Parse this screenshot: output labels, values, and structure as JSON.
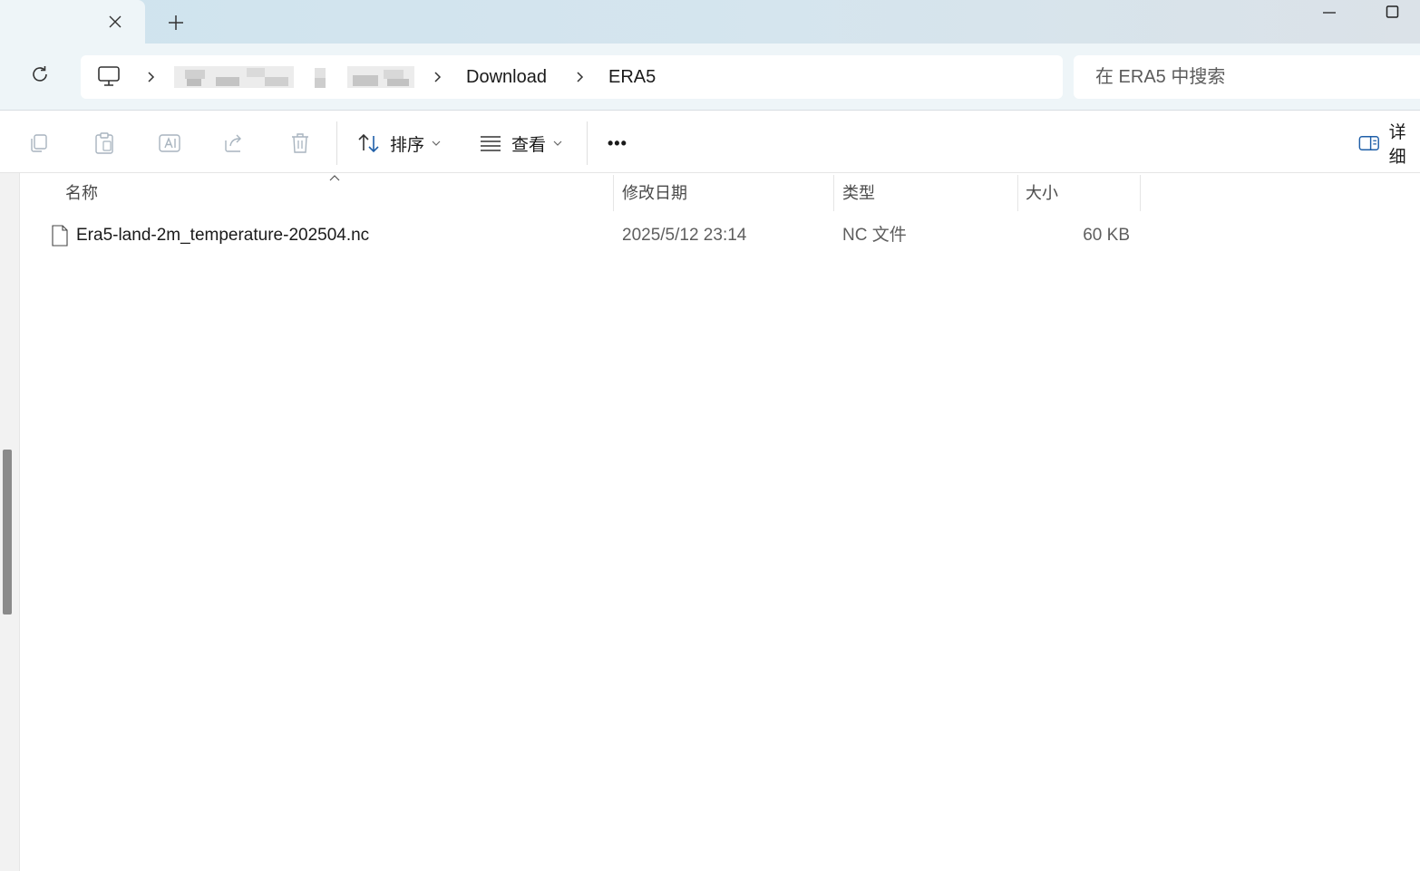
{
  "tab": {
    "close_label": "×",
    "new_tab_label": "+"
  },
  "address": {
    "crumbs": [
      "Download",
      "ERA5"
    ]
  },
  "search": {
    "placeholder": "在 ERA5 中搜索"
  },
  "toolbar": {
    "sort_label": "排序",
    "view_label": "查看",
    "more_label": "•••",
    "details_label": "详细"
  },
  "columns": {
    "name": "名称",
    "modified": "修改日期",
    "type": "类型",
    "size": "大小"
  },
  "files": [
    {
      "name": "Era5-land-2m_temperature-202504.nc",
      "modified": "2025/5/12 23:14",
      "type": "NC 文件",
      "size": "60 KB"
    }
  ],
  "colors": {
    "accent": "#0067c0",
    "disabled_icon": "#a8b4bf"
  }
}
